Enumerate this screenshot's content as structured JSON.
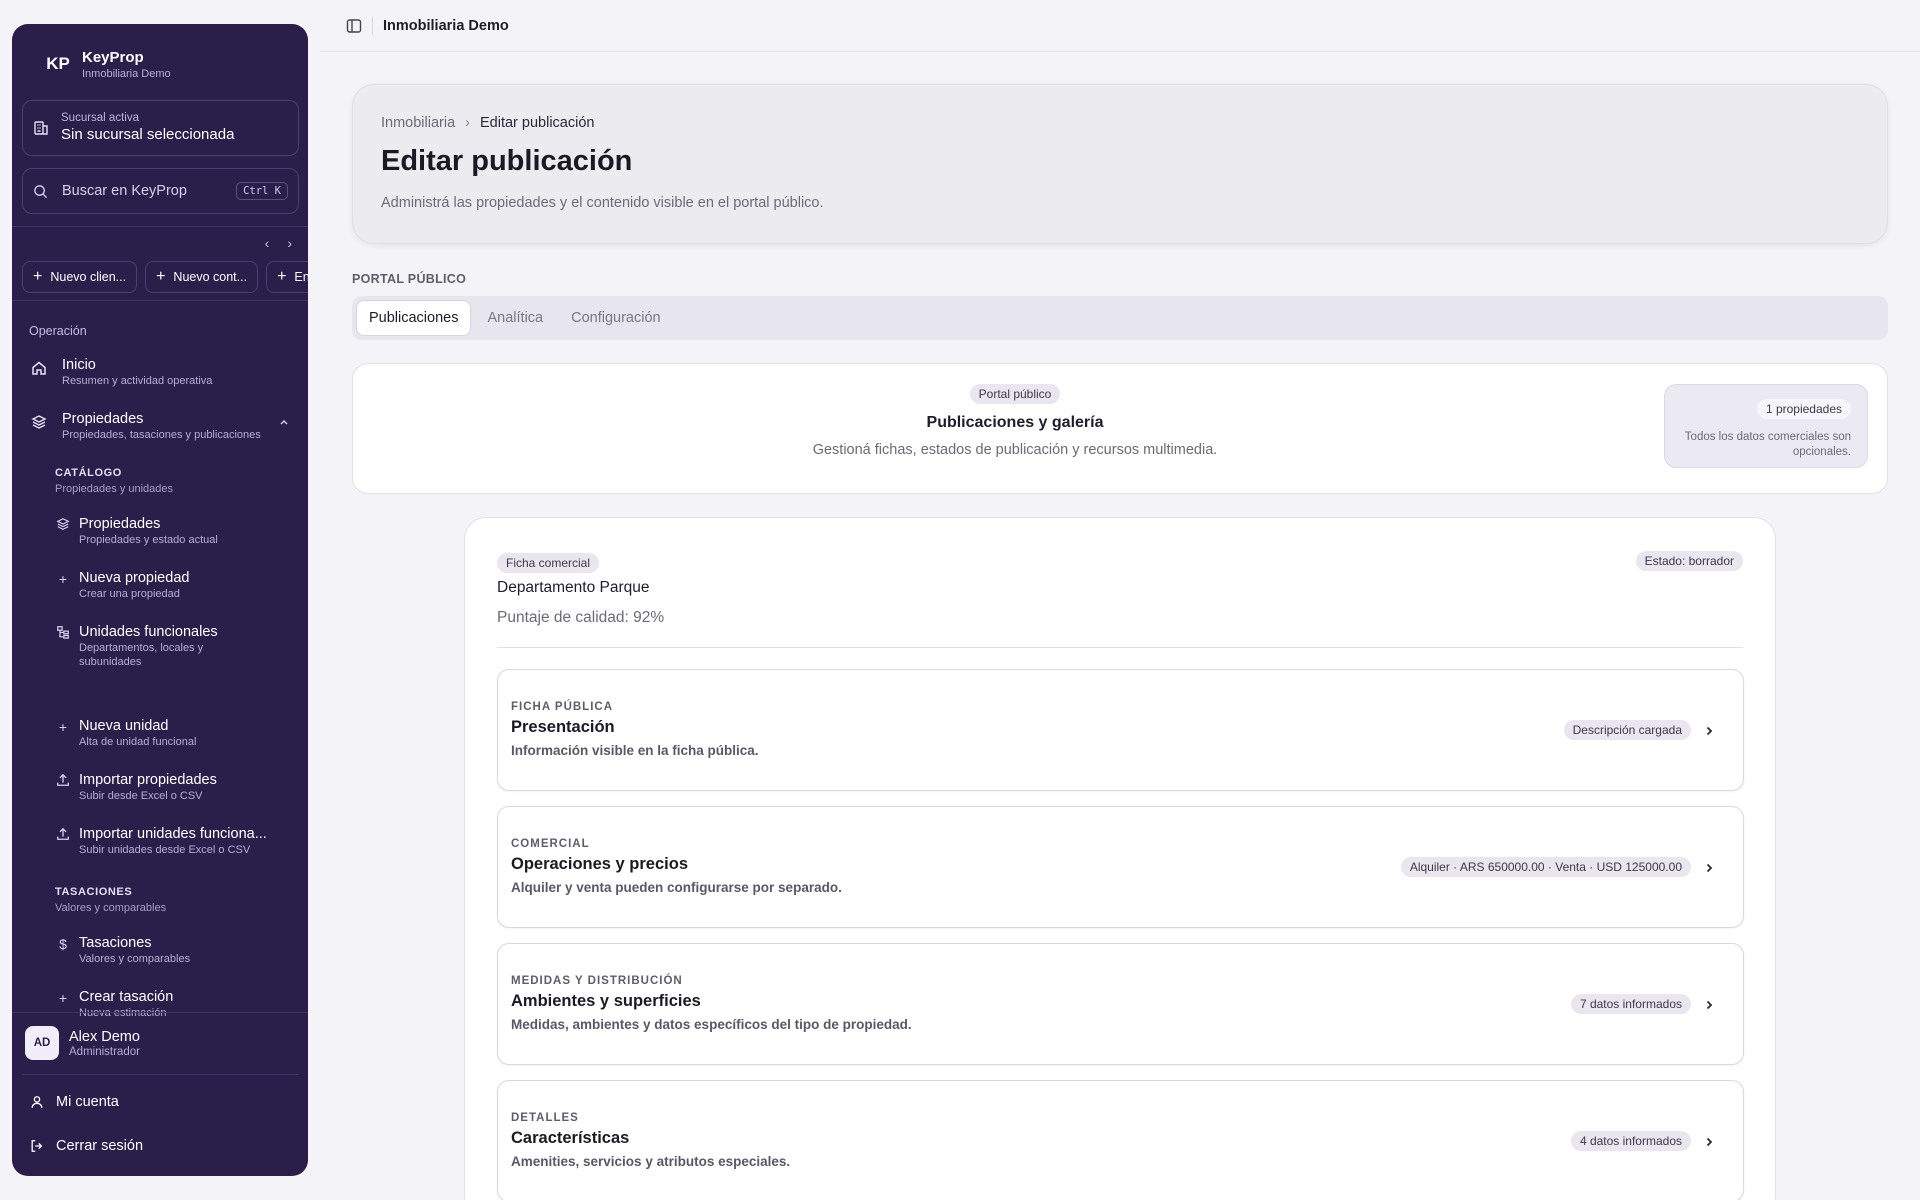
{
  "sidebar": {
    "brand": {
      "initials": "KP",
      "name": "KeyProp",
      "subtitle": "Inmobiliaria Demo"
    },
    "branch": {
      "label": "Sucursal activa",
      "value": "Sin sucursal seleccionada"
    },
    "search": {
      "placeholder": "Buscar en KeyProp",
      "shortcut": "Ctrl K"
    },
    "quick_actions": [
      "Nuevo clien...",
      "Nuevo cont...",
      "En"
    ],
    "section": "Operación",
    "nav": [
      {
        "label": "Inicio",
        "desc": "Resumen y actividad operativa"
      },
      {
        "label": "Propiedades",
        "desc": "Propiedades, tasaciones y publicaciones"
      }
    ],
    "groups": [
      {
        "title": "CATÁLOGO",
        "desc": "Propiedades y unidades"
      },
      {
        "title": "TASACIONES",
        "desc": "Valores y comparables"
      }
    ],
    "catalog_items": [
      {
        "label": "Propiedades",
        "desc": "Propiedades y estado actual"
      },
      {
        "label": "Nueva propiedad",
        "desc": "Crear una propiedad"
      },
      {
        "label": "Unidades funcionales",
        "desc": "Departamentos, locales y subunidades"
      },
      {
        "label": "Nueva unidad",
        "desc": "Alta de unidad funcional"
      },
      {
        "label": "Importar propiedades",
        "desc": "Subir desde Excel o CSV"
      },
      {
        "label": "Importar unidades funciona...",
        "desc": "Subir unidades desde Excel o CSV"
      }
    ],
    "tasacion_items": [
      {
        "label": "Tasaciones",
        "desc": "Valores y comparables"
      },
      {
        "label": "Crear tasación",
        "desc": "Nueva estimación"
      }
    ],
    "user": {
      "initials": "AD",
      "name": "Alex Demo",
      "role": "Administrador"
    },
    "footer": {
      "account": "Mi cuenta",
      "logout": "Cerrar sesión"
    }
  },
  "topbar": {
    "title": "Inmobiliaria Demo"
  },
  "header": {
    "breadcrumb": [
      "Inmobiliaria",
      "Editar publicación"
    ],
    "title": "Editar publicación",
    "description": "Administrá las propiedades y el contenido visible en el portal público."
  },
  "portal": {
    "label": "PORTAL PÚBLICO",
    "tabs": [
      "Publicaciones",
      "Analítica",
      "Configuración"
    ],
    "card": {
      "pill": "Portal público",
      "title": "Publicaciones y galería",
      "subtitle": "Gestioná fichas, estados de publicación y recursos multimedia.",
      "count": "1 propiedades",
      "note": "Todos los datos comerciales son opcionales."
    }
  },
  "ficha": {
    "pill": "Ficha comercial",
    "state": "Estado: borrador",
    "name": "Departamento Parque",
    "score": "Puntaje de calidad: 92%",
    "sections": [
      {
        "kicker": "FICHA PÚBLICA",
        "title": "Presentación",
        "desc": "Información visible en la ficha pública.",
        "badge": "Descripción cargada"
      },
      {
        "kicker": "COMERCIAL",
        "title": "Operaciones y precios",
        "desc": "Alquiler y venta pueden configurarse por separado.",
        "badge": "Alquiler · ARS 650000.00 · Venta · USD 125000.00"
      },
      {
        "kicker": "MEDIDAS Y DISTRIBUCIÓN",
        "title": "Ambientes y superficies",
        "desc": "Medidas, ambientes y datos específicos del tipo de propiedad.",
        "badge": "7 datos informados"
      },
      {
        "kicker": "DETALLES",
        "title": "Características",
        "desc": "Amenities, servicios y atributos especiales.",
        "badge": "4 datos informados"
      }
    ]
  }
}
